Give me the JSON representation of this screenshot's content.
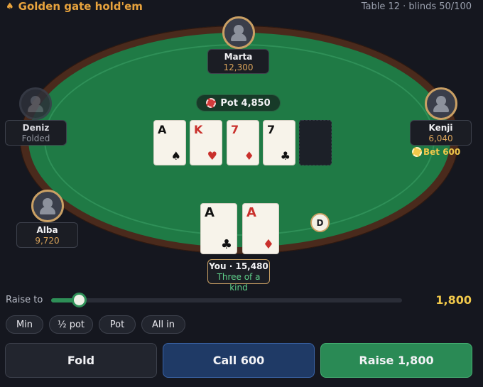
{
  "header": {
    "title": "Golden gate hold'em",
    "table_info": "Table 12 · blinds 50/100"
  },
  "players": {
    "marta": {
      "name": "Marta",
      "chips": "12,300"
    },
    "deniz": {
      "name": "Deniz",
      "status": "Folded"
    },
    "kenji": {
      "name": "Kenji",
      "chips": "6,040",
      "bet": "Bet 600"
    },
    "alba": {
      "name": "Alba",
      "chips": "9,720"
    }
  },
  "pot": {
    "label": "Pot 4,850"
  },
  "board": [
    {
      "rank": "A",
      "suit": "♠",
      "color": "black"
    },
    {
      "rank": "K",
      "suit": "♥",
      "color": "red"
    },
    {
      "rank": "7",
      "suit": "♦",
      "color": "red"
    },
    {
      "rank": "7",
      "suit": "♣",
      "color": "black"
    }
  ],
  "hero": {
    "label": "You · 15,480",
    "hand_name": "Three of a kind",
    "cards": [
      {
        "rank": "A",
        "suit": "♣",
        "color": "black"
      },
      {
        "rank": "A",
        "suit": "♦",
        "color": "red"
      }
    ]
  },
  "dealer_button": "D",
  "raise": {
    "label": "Raise to",
    "value": "1,800",
    "slider_fraction": 0.08
  },
  "presets": [
    "Min",
    "½ pot",
    "Pot",
    "All in"
  ],
  "actions": {
    "fold": "Fold",
    "call": "Call 600",
    "raise": "Raise 1,800"
  },
  "colors": {
    "felt": "#1f7a45",
    "rail": "#4a2a1c",
    "accent_gold": "#e8a33d",
    "call": "#1f3a66",
    "raise": "#2a8a55"
  }
}
